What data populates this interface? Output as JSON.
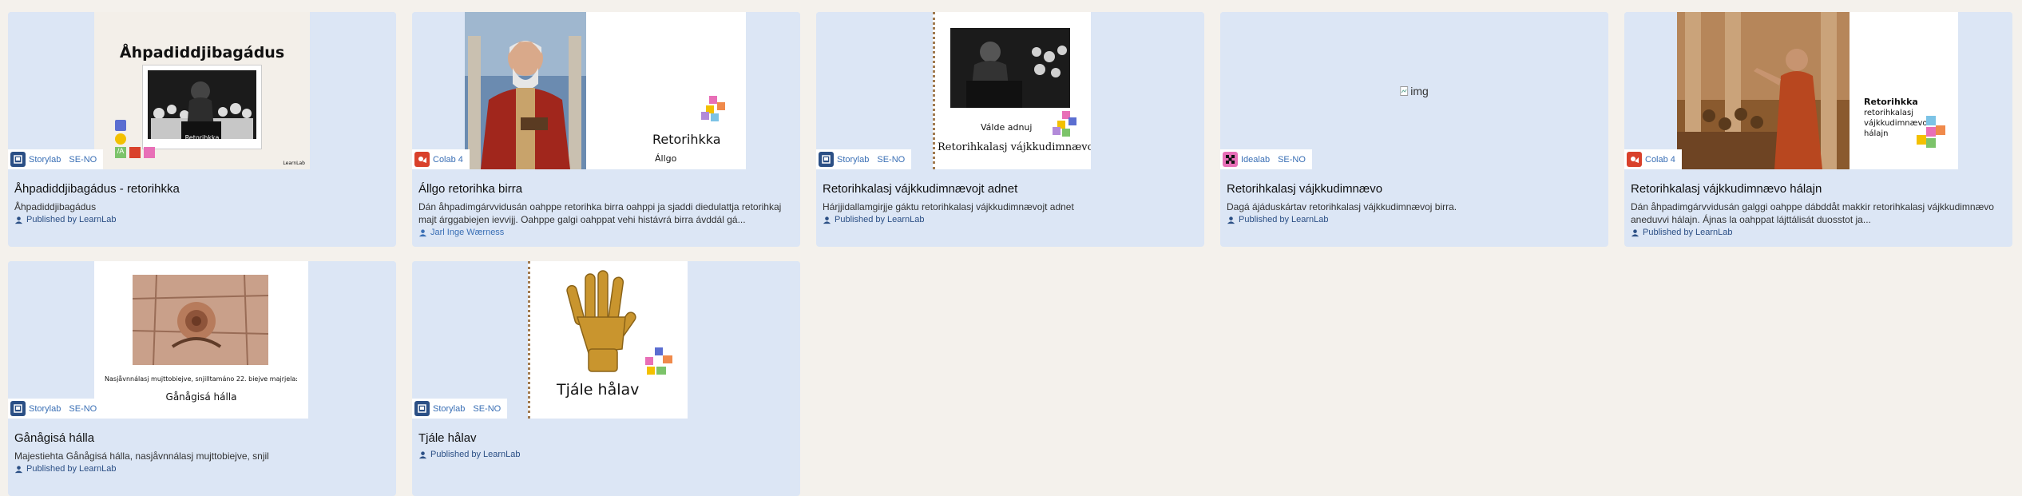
{
  "cards": [
    {
      "title": "Åhpadiddjibagádus - retorihkka",
      "desc": "Åhpadiddjibagádus",
      "publisher": "Published by LearnLab",
      "tool": "Storylab",
      "lang": "SE-NO",
      "thumb_heading": "Åhpadiddjibagádus",
      "thumb_small": "Retorihkka",
      "thumb_footer": "LearnLab"
    },
    {
      "title": "Állgo retorihka birra",
      "desc": "Dán åhpadimgárvvidusán oahppe retorihka birra oahppi ja sjaddi diedulattja retorihkaj majt árggabiejen ievvijj. Oahppe galgi oahppat vehi histávrá birra ávddál gá...",
      "publisher": "Jarl Inge Wærness",
      "tool": "Colab 4",
      "lang": "",
      "thumb_heading": "Retorihkka",
      "thumb_small": "Állgo"
    },
    {
      "title": "Retorihkalasj vájkkudimnævojt adnet",
      "desc": "Hárjjidallamgirjje gáktu retorihkalasj vájkkudimnævojt adnet",
      "publisher": "Published by LearnLab",
      "tool": "Storylab",
      "lang": "SE-NO",
      "thumb_small": "Válde adnuj",
      "thumb_heading": "Retorihkalasj vájkkudimnævoj"
    },
    {
      "title": "Retorihkalasj vájkkudimnævo",
      "desc": "Dagá ájáduskártav retorihkalasj vájkkudimnævoj birra.",
      "publisher": "Published by LearnLab",
      "tool": "Idealab",
      "lang": "SE-NO",
      "img_alt": "img"
    },
    {
      "title": "Retorihkalasj vájkkudimnævo hálajn",
      "desc": "Dán åhpadimgárvvidusán galggi oahppe dábddåt makkir retorihkalasj vájkkudimnævo aneduvvi hálajn. Ájnas la oahppat lájttálisát duosstot ja...",
      "publisher": "Published by LearnLab",
      "tool": "Colab 4",
      "lang": "",
      "thumb_heading": "Retorihkka",
      "thumb_sub": "retorihkalasj vájkkudimnævo hálajn"
    },
    {
      "title": "Gånågisá hálla",
      "desc": "Majestiehta Gånågisá hálla, nasjåvnnálasj mujttobiejve, snjil",
      "publisher": "Published by LearnLab",
      "tool": "Storylab",
      "lang": "SE-NO",
      "thumb_small": "Nasjåvnnálasj mujttobiejve, snjilltamáno 22. biejve majrjela:",
      "thumb_heading": "Gånågisá hálla"
    },
    {
      "title": "Tjále hålav",
      "desc": "",
      "publisher": "Published by LearnLab",
      "tool": "Storylab",
      "lang": "SE-NO",
      "thumb_heading": "Tjále hålav"
    }
  ],
  "colors": {
    "card_bg": "#dce6f5",
    "page_bg": "#f4f1ec",
    "link": "#3a6fb5",
    "storylab_icon": "#2b4f85",
    "colab_icon": "#d9412b",
    "idealab_icon": "#e86fb7"
  }
}
